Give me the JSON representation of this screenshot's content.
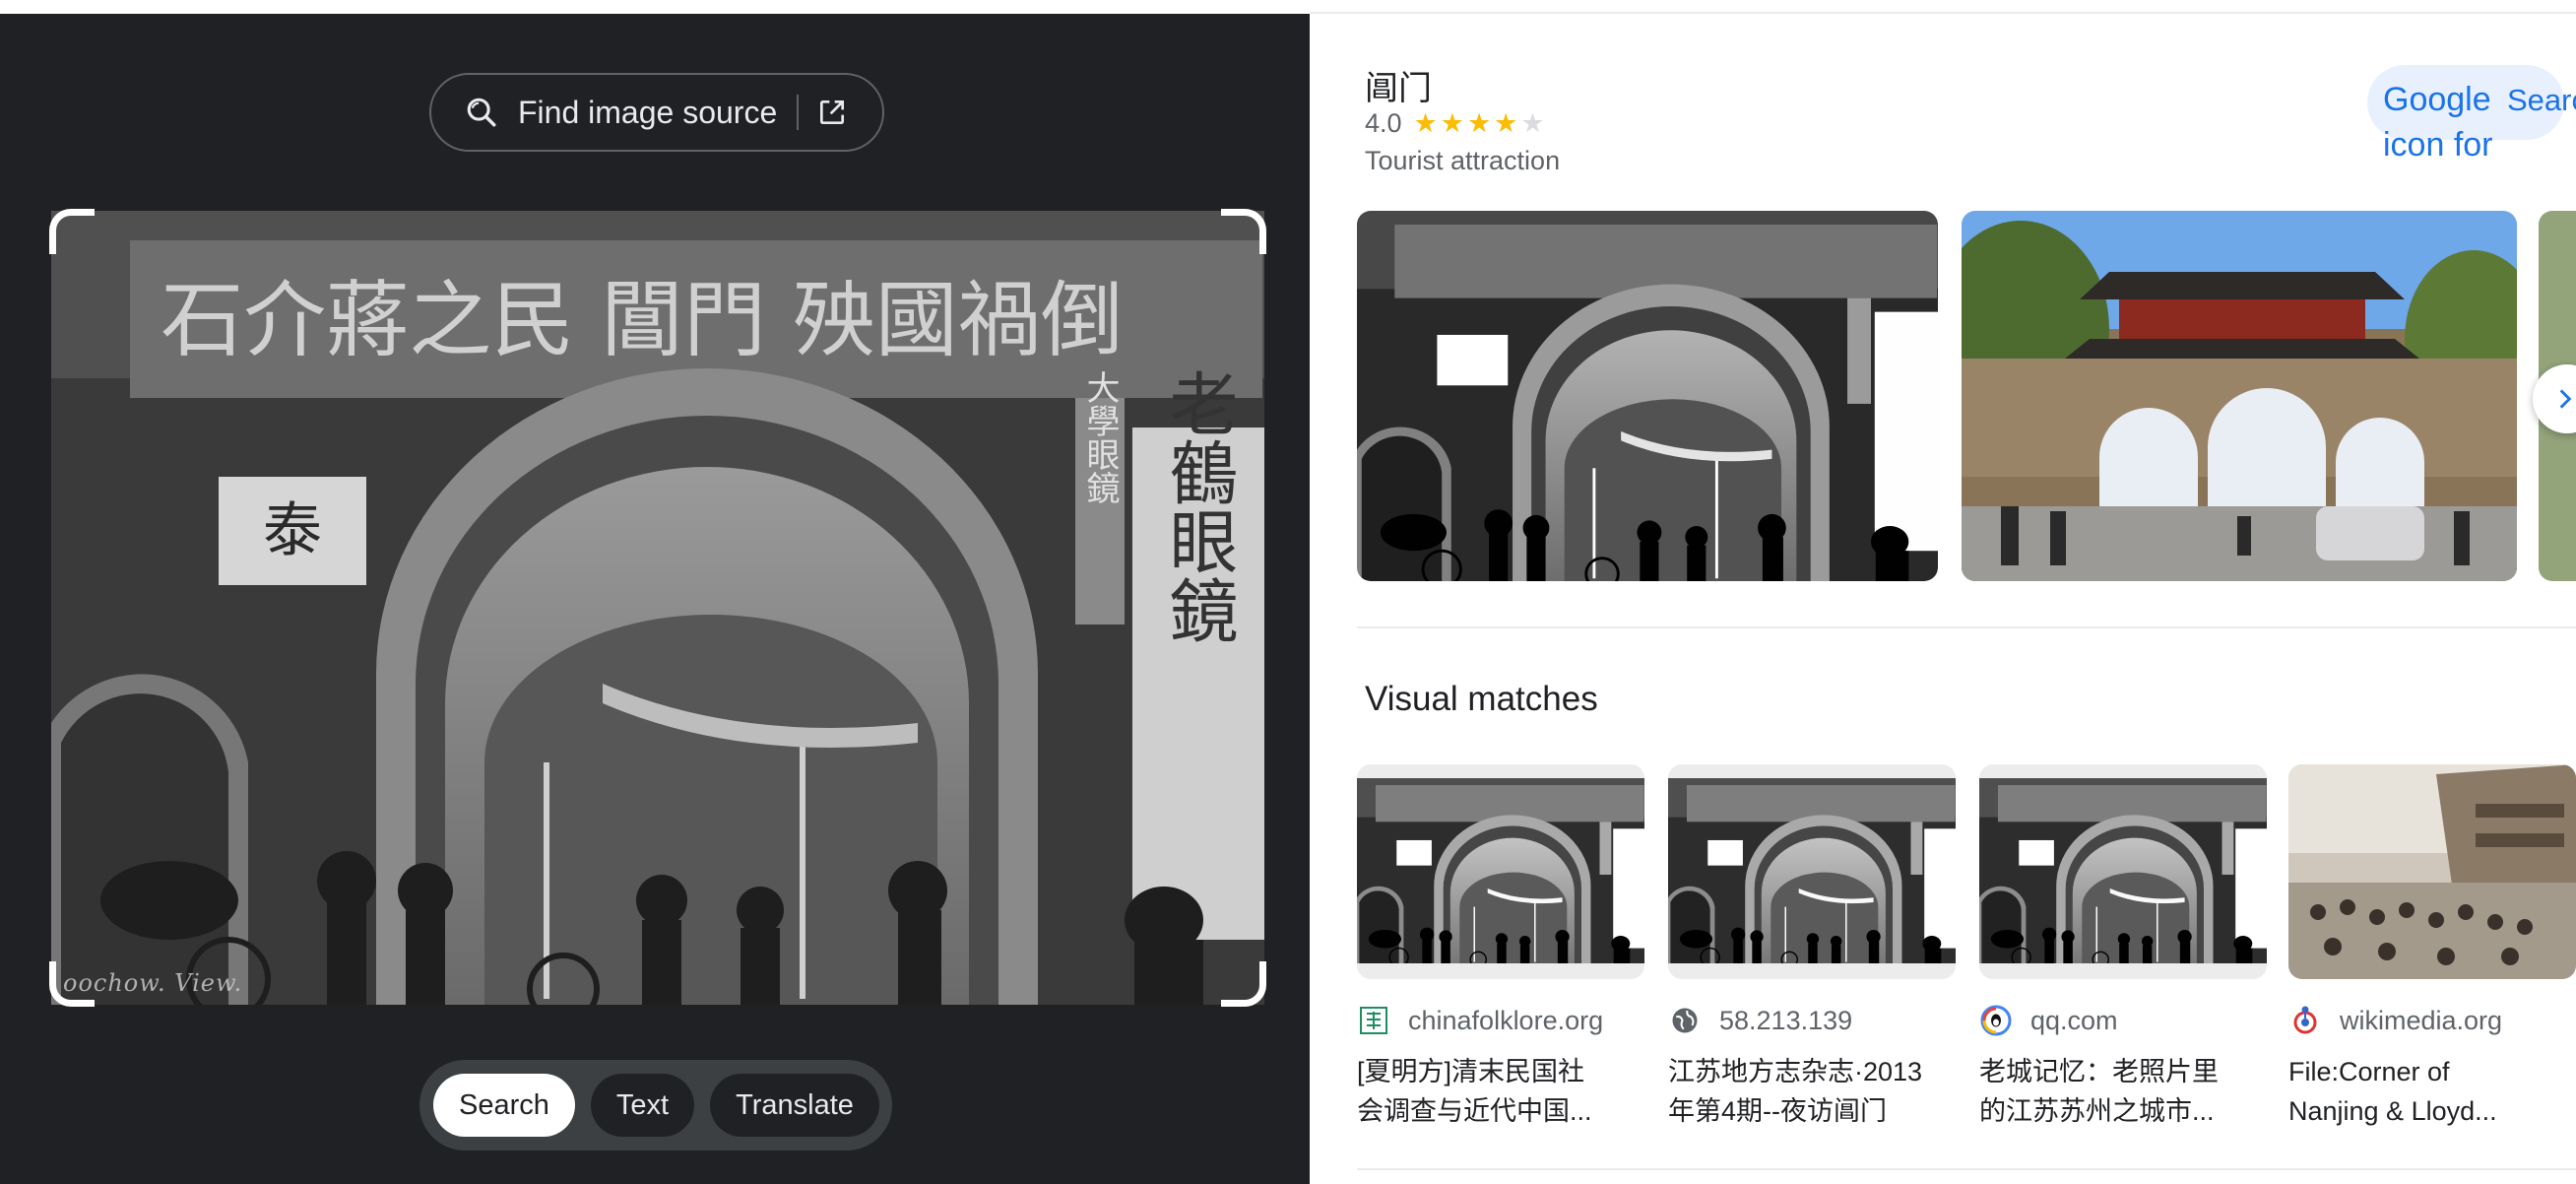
{
  "left_panel": {
    "find_source_label": "Find image source",
    "photo_caption": "oochow. View.",
    "photo_sign_text": "石介蔣之民 閶門 殃國禍倒",
    "photo_side_sign": "大學眼鏡",
    "photo_shop_sign": "老鶴眼鏡",
    "photo_small_sign": "泰",
    "modes": [
      "Search",
      "Text",
      "Translate"
    ],
    "active_mode": "Search"
  },
  "place": {
    "title": "阊门",
    "rating_value": "4.0",
    "rating_stars": 4,
    "rating_max": 5,
    "type": "Tourist attraction",
    "google_search_alt": "Google icon for",
    "google_search_label": "Search"
  },
  "visual_matches": {
    "heading": "Visual matches",
    "items": [
      {
        "domain": "chinafolklore.org",
        "favicon": "chinafolklore-favicon",
        "title_lines": [
          "[夏明方]清末民国社",
          "会调查与近代中国..."
        ]
      },
      {
        "domain": "58.213.139",
        "favicon": "globe-icon",
        "title_lines": [
          "江苏地方志杂志·2013",
          "年第4期--夜访阊门"
        ]
      },
      {
        "domain": "qq.com",
        "favicon": "qq-favicon",
        "title_lines": [
          "老城记忆：老照片里",
          "的江苏苏州之城市..."
        ]
      },
      {
        "domain": "wikimedia.org",
        "favicon": "wikimedia-favicon",
        "title_lines": [
          "File:Corner of",
          "Nanjing & Lloyd..."
        ]
      }
    ]
  },
  "colors": {
    "left_bg": "#202124",
    "accent_blue": "#1a73e8",
    "star": "#fbbc04"
  }
}
